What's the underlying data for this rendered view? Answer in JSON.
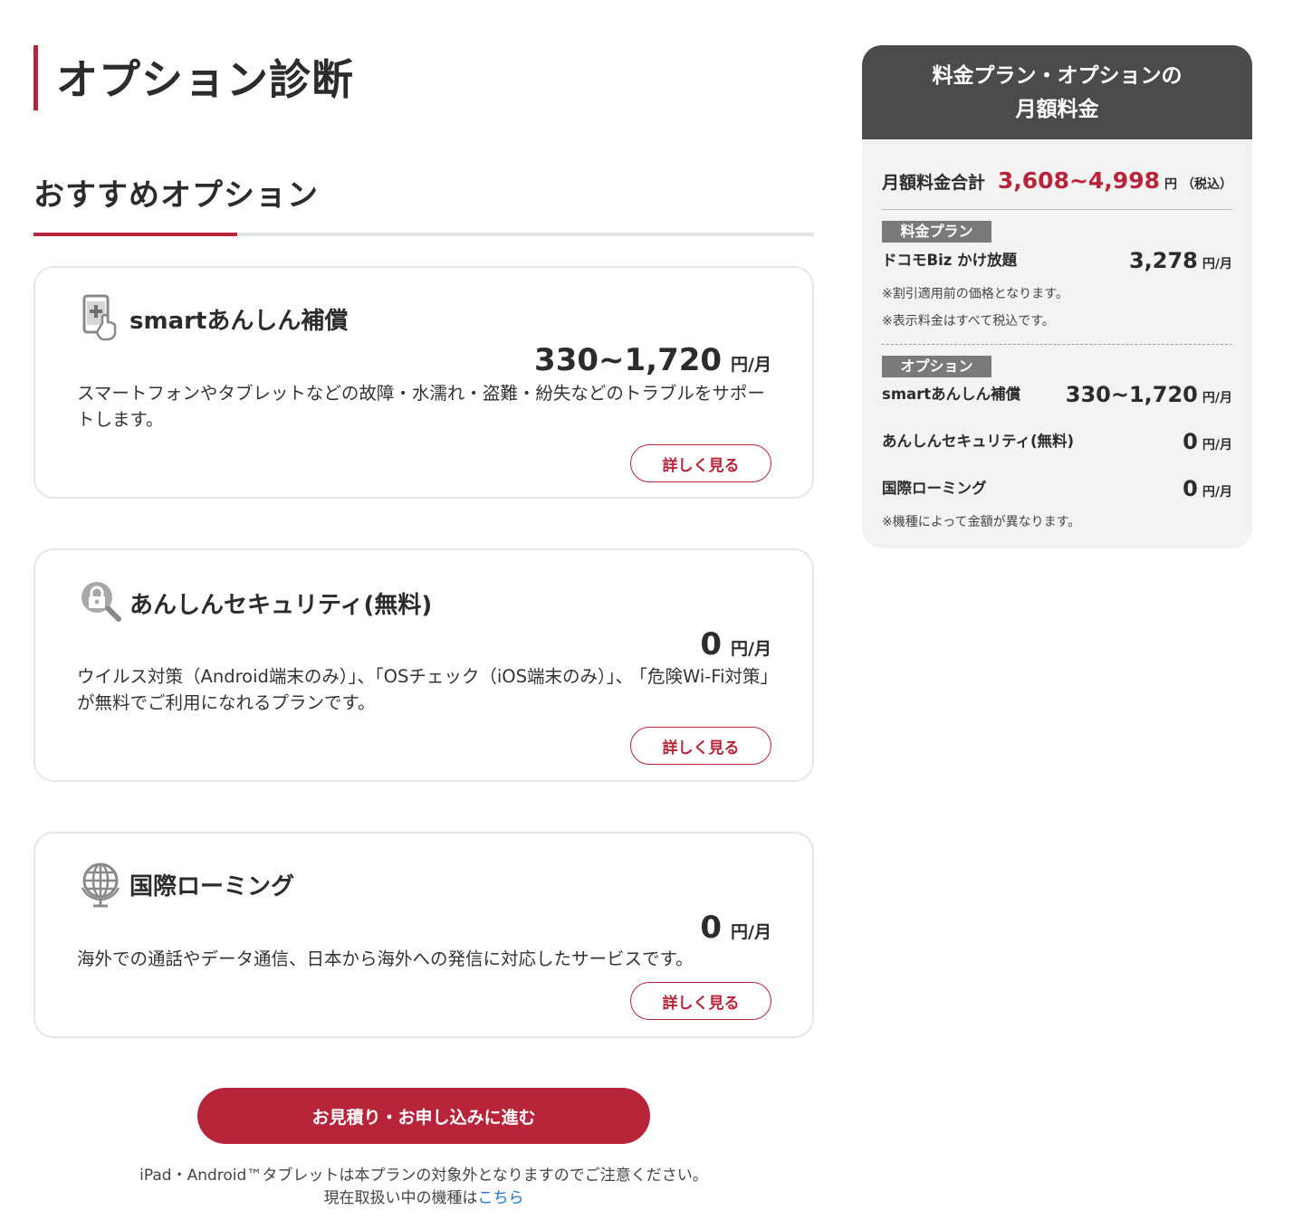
{
  "page_title": "オプション診断",
  "section_title": "おすすめオプション",
  "colors": {
    "accent": "#b8243a",
    "sidebar_header": "#4b4b4b",
    "sidebar_bg": "#f3f3f3",
    "link": "#1a73c8"
  },
  "options": [
    {
      "icon": "tablet-plus-icon",
      "title": "smartあんしん補償",
      "price": "330~1,720",
      "unit": "円/月",
      "description": "スマートフォンやタブレットなどの故障・水濡れ・盗難・紛失などのトラブルをサポートします。",
      "button": "詳しく見る"
    },
    {
      "icon": "lock-magnifier-icon",
      "title": "あんしんセキュリティ(無料)",
      "price": "0",
      "unit": "円/月",
      "description": "ウイルス対策（Android端末のみ）｣、｢OSチェック（iOS端末のみ）｣、 ｢危険Wi-Fi対策｣が無料でご利用になれるプランです。",
      "button": "詳しく見る"
    },
    {
      "icon": "globe-icon",
      "title": "国際ローミング",
      "price": "0",
      "unit": "円/月",
      "description": "海外での通話やデータ通信、日本から海外への発信に対応したサービスです。",
      "button": "詳しく見る"
    }
  ],
  "cta": "お見積り・お申し込みに進む",
  "footer_note": {
    "line1": "iPad・Android™タブレットは本プランの対象外となりますのでご注意ください。",
    "line2_prefix": "現在取扱い中の機種は",
    "line2_link": "こちら"
  },
  "sidebar": {
    "title_line1": "料金プラン・オプションの",
    "title_line2": "月額料金",
    "total_label": "月額料金合計",
    "total_value": "3,608~4,998",
    "total_unit": "円",
    "total_tax": "（税込）",
    "plan_tag": "料金プラン",
    "plan_name": "ドコモBiz かけ放題",
    "plan_price": "3,278",
    "plan_unit": "円/月",
    "plan_note1": "※割引適用前の価格となります。",
    "plan_note2": "※表示料金はすべて税込です。",
    "option_tag": "オプション",
    "option_rows": [
      {
        "label": "smartあんしん補償",
        "price": "330~1,720",
        "unit": "円/月"
      },
      {
        "label": "あんしんセキュリティ(無料)",
        "price": "0",
        "unit": "円/月"
      },
      {
        "label": "国際ローミング",
        "price": "0",
        "unit": "円/月"
      }
    ],
    "option_note": "※機種によって金額が異なります。"
  }
}
